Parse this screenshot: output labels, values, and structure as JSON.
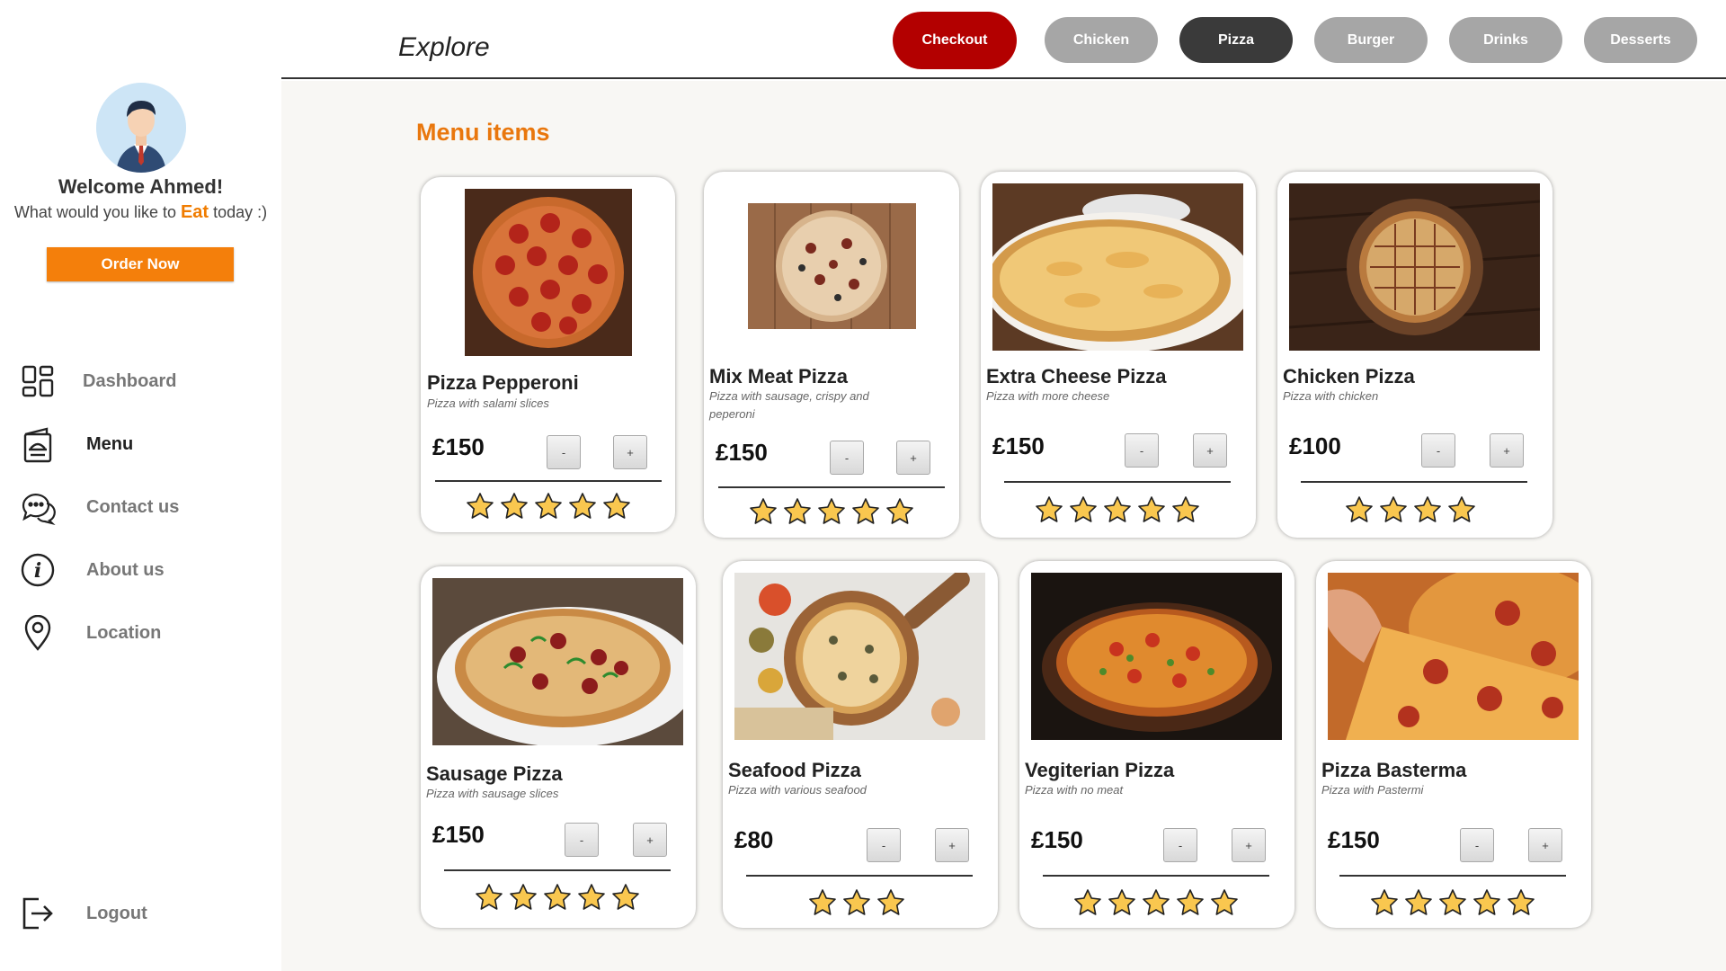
{
  "sidebar": {
    "welcome": "Welcome Ahmed!",
    "subtitle_pre": "What would you like to ",
    "subtitle_eat": "Eat",
    "subtitle_post": " today :)",
    "order_button": "Order Now",
    "nav": [
      {
        "label": "Dashboard",
        "icon": "dashboard-icon"
      },
      {
        "label": "Menu",
        "icon": "menu-icon"
      },
      {
        "label": "Contact us",
        "icon": "chat-icon"
      },
      {
        "label": "About us",
        "icon": "info-icon"
      },
      {
        "label": "Location",
        "icon": "location-pin-icon"
      }
    ],
    "logout": "Logout"
  },
  "topbar": {
    "title": "Explore",
    "tabs": [
      {
        "label": "Checkout",
        "color": "#b30000"
      },
      {
        "label": "Chicken",
        "color": "#a6a6a6"
      },
      {
        "label": "Pizza",
        "color": "#3a3a3a"
      },
      {
        "label": "Burger",
        "color": "#a6a6a6"
      },
      {
        "label": "Drinks",
        "color": "#a6a6a6"
      },
      {
        "label": "Desserts",
        "color": "#a6a6a6"
      }
    ]
  },
  "main": {
    "title": "Menu items",
    "qty_minus": "-",
    "qty_plus": "+",
    "items": [
      {
        "name": "Pizza Pepperoni",
        "desc": "Pizza with salami slices",
        "price": "£150",
        "rating": 5
      },
      {
        "name": "Mix Meat Pizza",
        "desc": "Pizza with sausage, crispy and peperoni",
        "price": "£150",
        "rating": 5
      },
      {
        "name": "Extra Cheese Pizza",
        "desc": "Pizza with more cheese",
        "price": "£150",
        "rating": 5
      },
      {
        "name": "Chicken Pizza",
        "desc": "Pizza with chicken",
        "price": "£100",
        "rating": 4
      },
      {
        "name": "Sausage Pizza",
        "desc": "Pizza with sausage slices",
        "price": "£150",
        "rating": 5
      },
      {
        "name": "Seafood Pizza",
        "desc": "Pizza with various seafood",
        "price": "£80",
        "rating": 3
      },
      {
        "name": "Vegiterian Pizza",
        "desc": "Pizza with no meat",
        "price": "£150",
        "rating": 5
      },
      {
        "name": "Pizza Basterma",
        "desc": "Pizza with Pastermi",
        "price": "£150",
        "rating": 5
      }
    ]
  },
  "colors": {
    "accent": "#f47f0b",
    "checkout": "#b30000",
    "active_tab": "#3a3a3a",
    "inactive_tab": "#a6a6a6",
    "star": "#f9c74f"
  }
}
